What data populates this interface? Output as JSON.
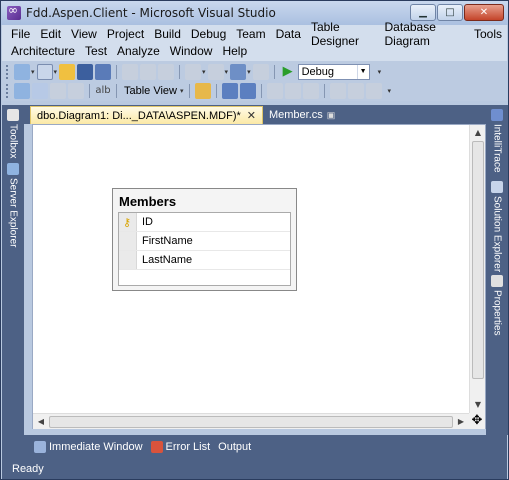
{
  "window": {
    "title": "Fdd.Aspen.Client - Microsoft Visual Studio",
    "minimize": "▁",
    "maximize": "□",
    "close": "✕"
  },
  "menu": {
    "row1": [
      "File",
      "Edit",
      "View",
      "Project",
      "Build",
      "Debug",
      "Team",
      "Data",
      "Table Designer",
      "Database Diagram",
      "Tools"
    ],
    "row2": [
      "Architecture",
      "Test",
      "Analyze",
      "Window",
      "Help"
    ]
  },
  "toolbar": {
    "config_combo": "Debug",
    "table_view_label": "Table View"
  },
  "left_tabs": [
    "Toolbox",
    "Server Explorer"
  ],
  "right_tabs": [
    "IntelliTrace",
    "Solution Explorer",
    "Properties"
  ],
  "doc_tabs": {
    "active": "dbo.Diagram1: Di..._DATA\\ASPEN.MDF)*",
    "active_close": "✕",
    "inactive": "Member.cs"
  },
  "diagram": {
    "table_name": "Members",
    "columns": [
      {
        "name": "ID",
        "primary_key": true
      },
      {
        "name": "FirstName",
        "primary_key": false
      },
      {
        "name": "LastName",
        "primary_key": false
      }
    ]
  },
  "bottom_tabs": [
    "Immediate Window",
    "Error List",
    "Output"
  ],
  "status": "Ready",
  "colors": {
    "chrome": "#4d6185",
    "menubar": "#d3deed",
    "active_tab": "#fbe9a6"
  }
}
